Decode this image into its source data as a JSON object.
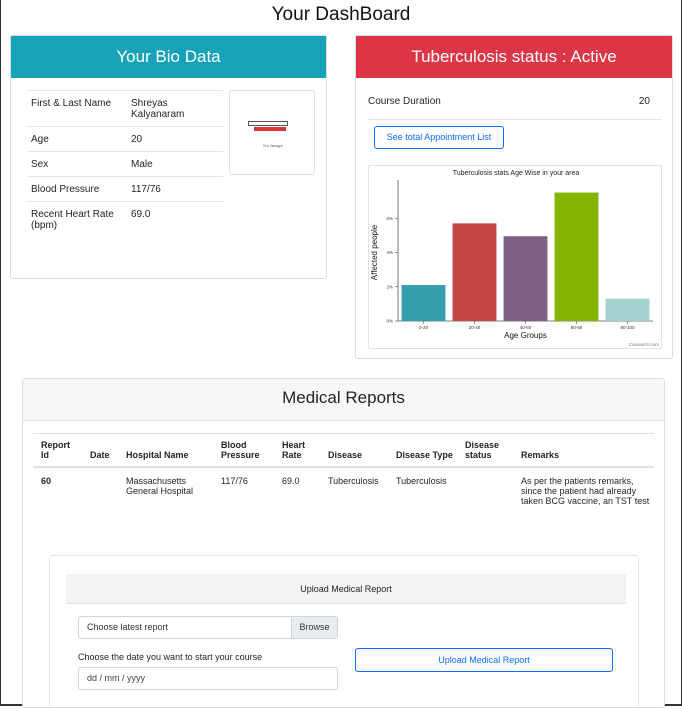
{
  "page": {
    "title": "Your DashBoard"
  },
  "bio": {
    "title": "Your Bio Data",
    "rows": [
      {
        "label": "First & Last Name",
        "value": "Shreyas Kalyanaram"
      },
      {
        "label": "Age",
        "value": "20"
      },
      {
        "label": "Sex",
        "value": "Male"
      },
      {
        "label": "Blood Pressure",
        "value": "117/76"
      },
      {
        "label": "Recent Heart Rate (bpm)",
        "value": "69.0"
      }
    ],
    "no_image_caption": "No Image"
  },
  "tb": {
    "title": "Tuberculosis status : Active",
    "course_label": "Course Duration",
    "course_value": "20",
    "appointments_button": "See total Appointment List"
  },
  "chart_data": {
    "type": "bar",
    "title": "Tuberculosis stats Age Wise in your area",
    "xlabel": "Age Groups",
    "ylabel": "Affected people",
    "categories": [
      "0-20",
      "20-40",
      "40-60",
      "60-80",
      "80-100"
    ],
    "values": [
      2.1,
      5.7,
      4.95,
      7.5,
      1.3
    ],
    "ylim": [
      0,
      8
    ],
    "ytick_values": [
      0,
      2,
      4,
      6
    ],
    "ytick_labels": [
      "0%",
      "2%",
      "4%",
      "6%"
    ],
    "colors": [
      "#369EAD",
      "#C24642",
      "#7F6084",
      "#86B402",
      "#A2D1CF"
    ],
    "credit": "CanvasJS.com"
  },
  "reports": {
    "title": "Medical Reports",
    "columns": [
      "Report Id",
      "Date",
      "Hospital Name",
      "Blood Pressure",
      "Heart Rate",
      "Disease",
      "Disease Type",
      "Disease status",
      "Remarks"
    ],
    "rows": [
      [
        "60",
        "",
        "Massachusetts General Hospital",
        "117/76",
        "69.0",
        "Tuberculosis",
        "Tuberculosis",
        "",
        "As per the patients remarks, since the patient had already taken BCG vaccine, an TST test"
      ]
    ]
  },
  "upload": {
    "title": "Upload Medical Report",
    "file_placeholder": "Choose latest report",
    "browse_label": "Browse",
    "date_label": "Choose the date you want to start your course",
    "date_placeholder": "dd / mm / yyyy",
    "submit_label": "Upload Medical Report"
  }
}
